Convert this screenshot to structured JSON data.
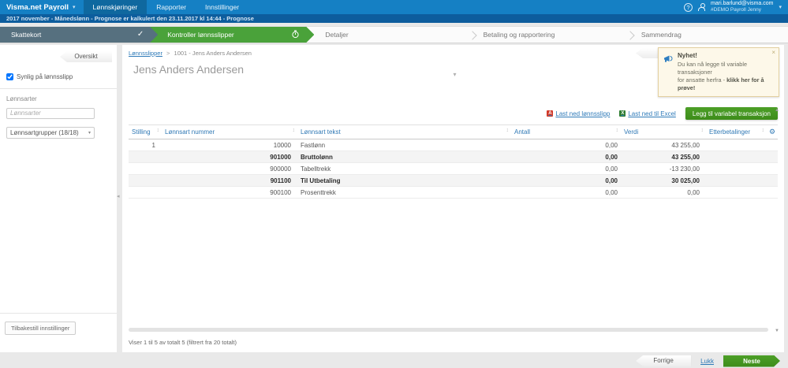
{
  "topnav": {
    "brand": "Visma.net Payroll",
    "items": [
      {
        "label": "Lønnskjøringer",
        "active": true
      },
      {
        "label": "Rapporter",
        "active": false
      },
      {
        "label": "Innstillinger",
        "active": false
      }
    ],
    "user": {
      "email": "mari.barlund@visma.com",
      "org": "#DEMO Payroll Jenny"
    }
  },
  "subheader": {
    "text": "2017 november - Månedslønn - Prognose er kalkulert den 23.11.2017 kl 14:44 - Prognose"
  },
  "stepper": {
    "steps": [
      {
        "label": "Skattekort"
      },
      {
        "label": "Kontroller lønnsslipper"
      },
      {
        "label": "Detaljer"
      },
      {
        "label": "Betaling og rapportering"
      },
      {
        "label": "Sammendrag"
      }
    ]
  },
  "sidebar": {
    "overview_button": "Oversikt",
    "visible_checkbox_label": "Synlig på lønnsslipp",
    "wage_types_label": "Lønnsarter",
    "wage_types_placeholder": "Lønnsarter",
    "group_select_value": "Lønnsartgrupper (18/18)",
    "reset_button": "Tilbakestill innstillinger"
  },
  "main": {
    "breadcrumb": {
      "link": "Lønnsslipper",
      "sep": ">",
      "current": "1001 - Jens Anders Andersen"
    },
    "title": "Jens Anders Andersen",
    "notification": {
      "title": "Nyhet!",
      "line1": "Du kan nå legge til variable transaksjoner",
      "line2_prefix": "for ansatte herfra - ",
      "line2_bold": "klikk her for å prøve!",
      "close": "×"
    },
    "actions": {
      "download_pdf": "Last ned lønnsslipp",
      "download_excel": "Last ned til Excel",
      "add_transaction": "Legg til variabel transaksjon"
    },
    "table": {
      "headers": [
        "Stilling",
        "Lønnsart nummer",
        "Lønnsart tekst",
        "Antall",
        "Verdi",
        "Etterbetalinger"
      ],
      "rows": [
        [
          "1",
          "10000",
          "Fastlønn",
          "0,00",
          "43 255,00",
          ""
        ],
        [
          "",
          "901000",
          "Bruttolønn",
          "0,00",
          "43 255,00",
          ""
        ],
        [
          "",
          "900000",
          "Tabelltrekk",
          "0,00",
          "-13 230,00",
          ""
        ],
        [
          "",
          "901100",
          "Til Utbetaling",
          "0,00",
          "30 025,00",
          ""
        ],
        [
          "",
          "900100",
          "Prosenttrekk",
          "0,00",
          "0,00",
          ""
        ]
      ],
      "summary": "Viser 1 til 5 av totalt 5 (filtrert fra 20 totalt)"
    }
  },
  "footer": {
    "prev": "Forrige",
    "close": "Lukk",
    "next": "Neste"
  },
  "icons": {
    "sort": "↕",
    "gear": "⚙",
    "caret_down": "▾",
    "caret_left": "◂",
    "check": "✓",
    "scroll_up": "▲",
    "scroll_down": "▼",
    "help": "?",
    "pdf": "A",
    "excel": "X"
  },
  "colors": {
    "nav_blue": "#1580c4",
    "subheader_blue": "#0d5d9d",
    "step_done": "#56707f",
    "step_active": "#4aa23a",
    "accent_green": "#3d8c1a",
    "link_blue": "#2e7ab8",
    "notif_bg": "#fdf8e9"
  }
}
